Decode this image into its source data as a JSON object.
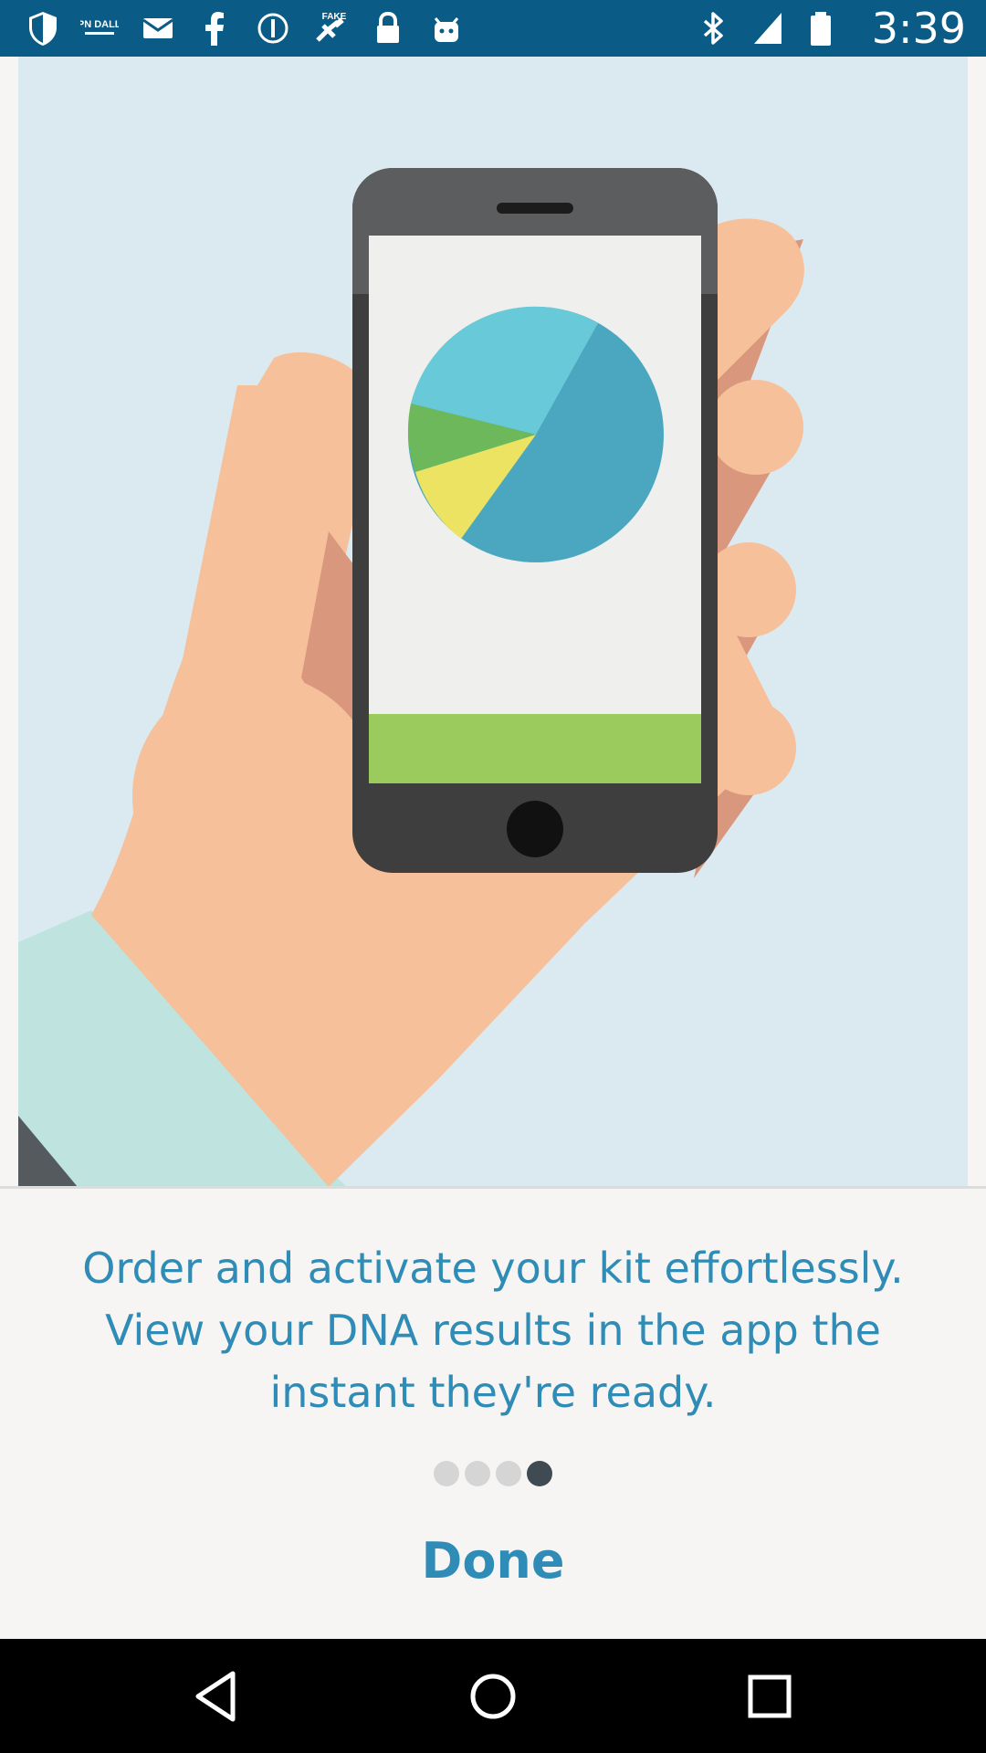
{
  "status_bar": {
    "time": "3:39",
    "left_icons": [
      "shield-icon",
      "espn-dallas-icon",
      "mail-icon",
      "facebook-icon",
      "info-circle-icon",
      "fake-gps-icon",
      "lock-icon",
      "android-icon"
    ],
    "right_icons": [
      "bluetooth-icon",
      "signal-icon",
      "battery-icon"
    ],
    "background_color": "#0a5b86",
    "espn_icon_text": "ESPN DALLAS",
    "fake_icon_text": "FAKE"
  },
  "onboarding": {
    "illustration": "hand-holding-phone-with-pie-chart",
    "message_lines": [
      "Order and activate your kit effortlessly.",
      "View your DNA results in the app the",
      "instant they're ready."
    ],
    "page_count": 4,
    "current_page": 4,
    "done_label": "Done",
    "accent_color": "#2f8cb6"
  },
  "nav_bar": {
    "buttons": [
      "back-icon",
      "home-icon",
      "recents-icon"
    ]
  }
}
